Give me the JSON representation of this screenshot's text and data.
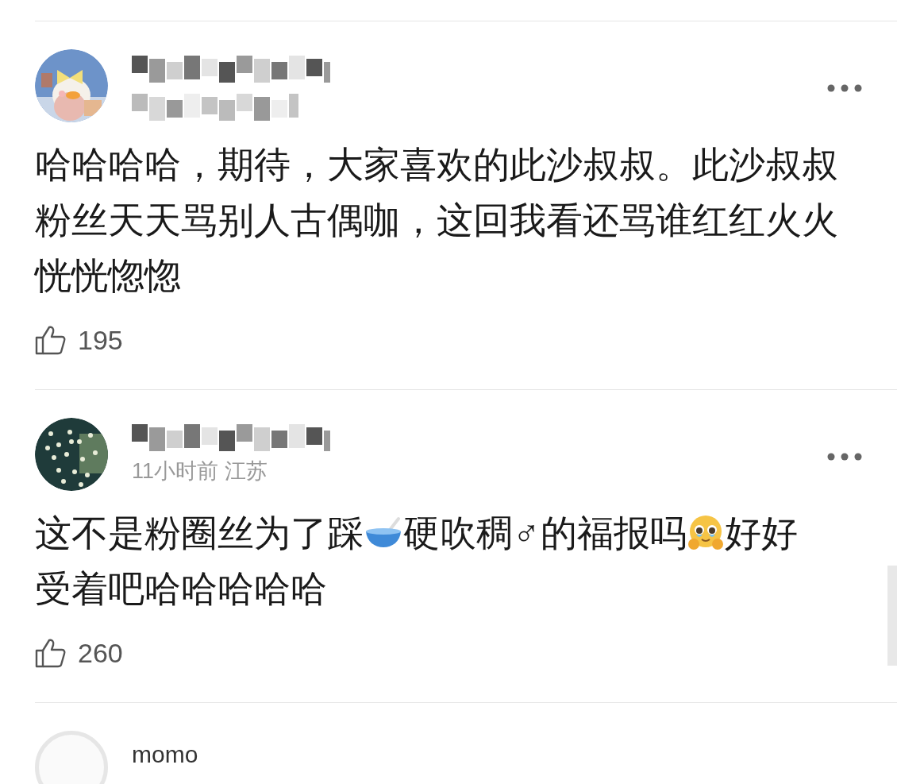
{
  "comments": [
    {
      "name_blurred": true,
      "time_blurred": true,
      "content": [
        {
          "kind": "text",
          "text": "哈哈哈哈，期待，大家喜欢的此沙叔叔。此沙叔叔粉丝天天骂别人古偶咖，这回我看还骂谁红红火火恍恍惚惚"
        }
      ],
      "likes": "195"
    },
    {
      "name_blurred": true,
      "time": "11小时前 江苏",
      "content": [
        {
          "kind": "text",
          "text": "这不是粉圈丝为了踩"
        },
        {
          "kind": "bowl"
        },
        {
          "kind": "text",
          "text": "硬吹稠"
        },
        {
          "kind": "text",
          "text": "♂"
        },
        {
          "kind": "text",
          "text": "的福报吗"
        },
        {
          "kind": "face"
        },
        {
          "kind": "text",
          "text": "好好"
        },
        {
          "kind": "text",
          "text": "受着吧哈哈哈哈哈"
        }
      ],
      "likes": "260"
    },
    {
      "avatar": {
        "kind": "default"
      },
      "name": "momo"
    }
  ]
}
